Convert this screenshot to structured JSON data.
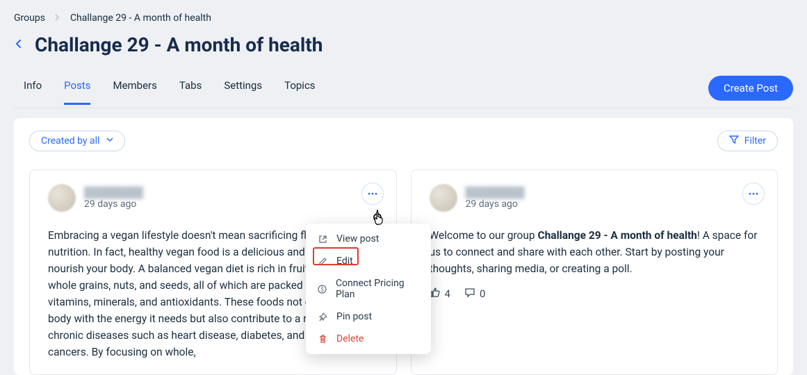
{
  "breadcrumbs": {
    "root": "Groups",
    "current": "Challange 29 - A month of health"
  },
  "page_title": "Challange 29 - A month of health",
  "tabs": {
    "info": "Info",
    "posts": "Posts",
    "members": "Members",
    "tabs": "Tabs",
    "settings": "Settings",
    "topics": "Topics"
  },
  "create_post": "Create Post",
  "toolbar": {
    "created_by": "Created by all",
    "filter": "Filter"
  },
  "menu": {
    "view": "View post",
    "edit": "Edit",
    "connect": "Connect Pricing Plan",
    "pin": "Pin post",
    "delete": "Delete"
  },
  "post1": {
    "author": "████████",
    "timestamp": "29 days ago",
    "body": "Embracing a vegan lifestyle doesn't mean sacrificing flavor or nutrition. In fact, healthy vegan food is a delicious and vibrant way to nourish your body. A balanced vegan diet is rich in fruits, vegetables, whole grains, nuts, and seeds, all of which are packed with essential vitamins, minerals, and antioxidants. These foods not only fuel your body with the energy it needs but also contribute to a reduced risk of chronic diseases such as heart disease, diabetes, and certain cancers. By focusing on whole,"
  },
  "post2": {
    "author": "████████",
    "timestamp": "29 days ago",
    "body_pre": "Welcome to our group ",
    "body_bold": "Challange 29 - A month of health",
    "body_post": "! A space for us to connect and share with each other. Start by posting your thoughts, sharing media, or creating a poll.",
    "likes": "4",
    "comments": "0"
  }
}
